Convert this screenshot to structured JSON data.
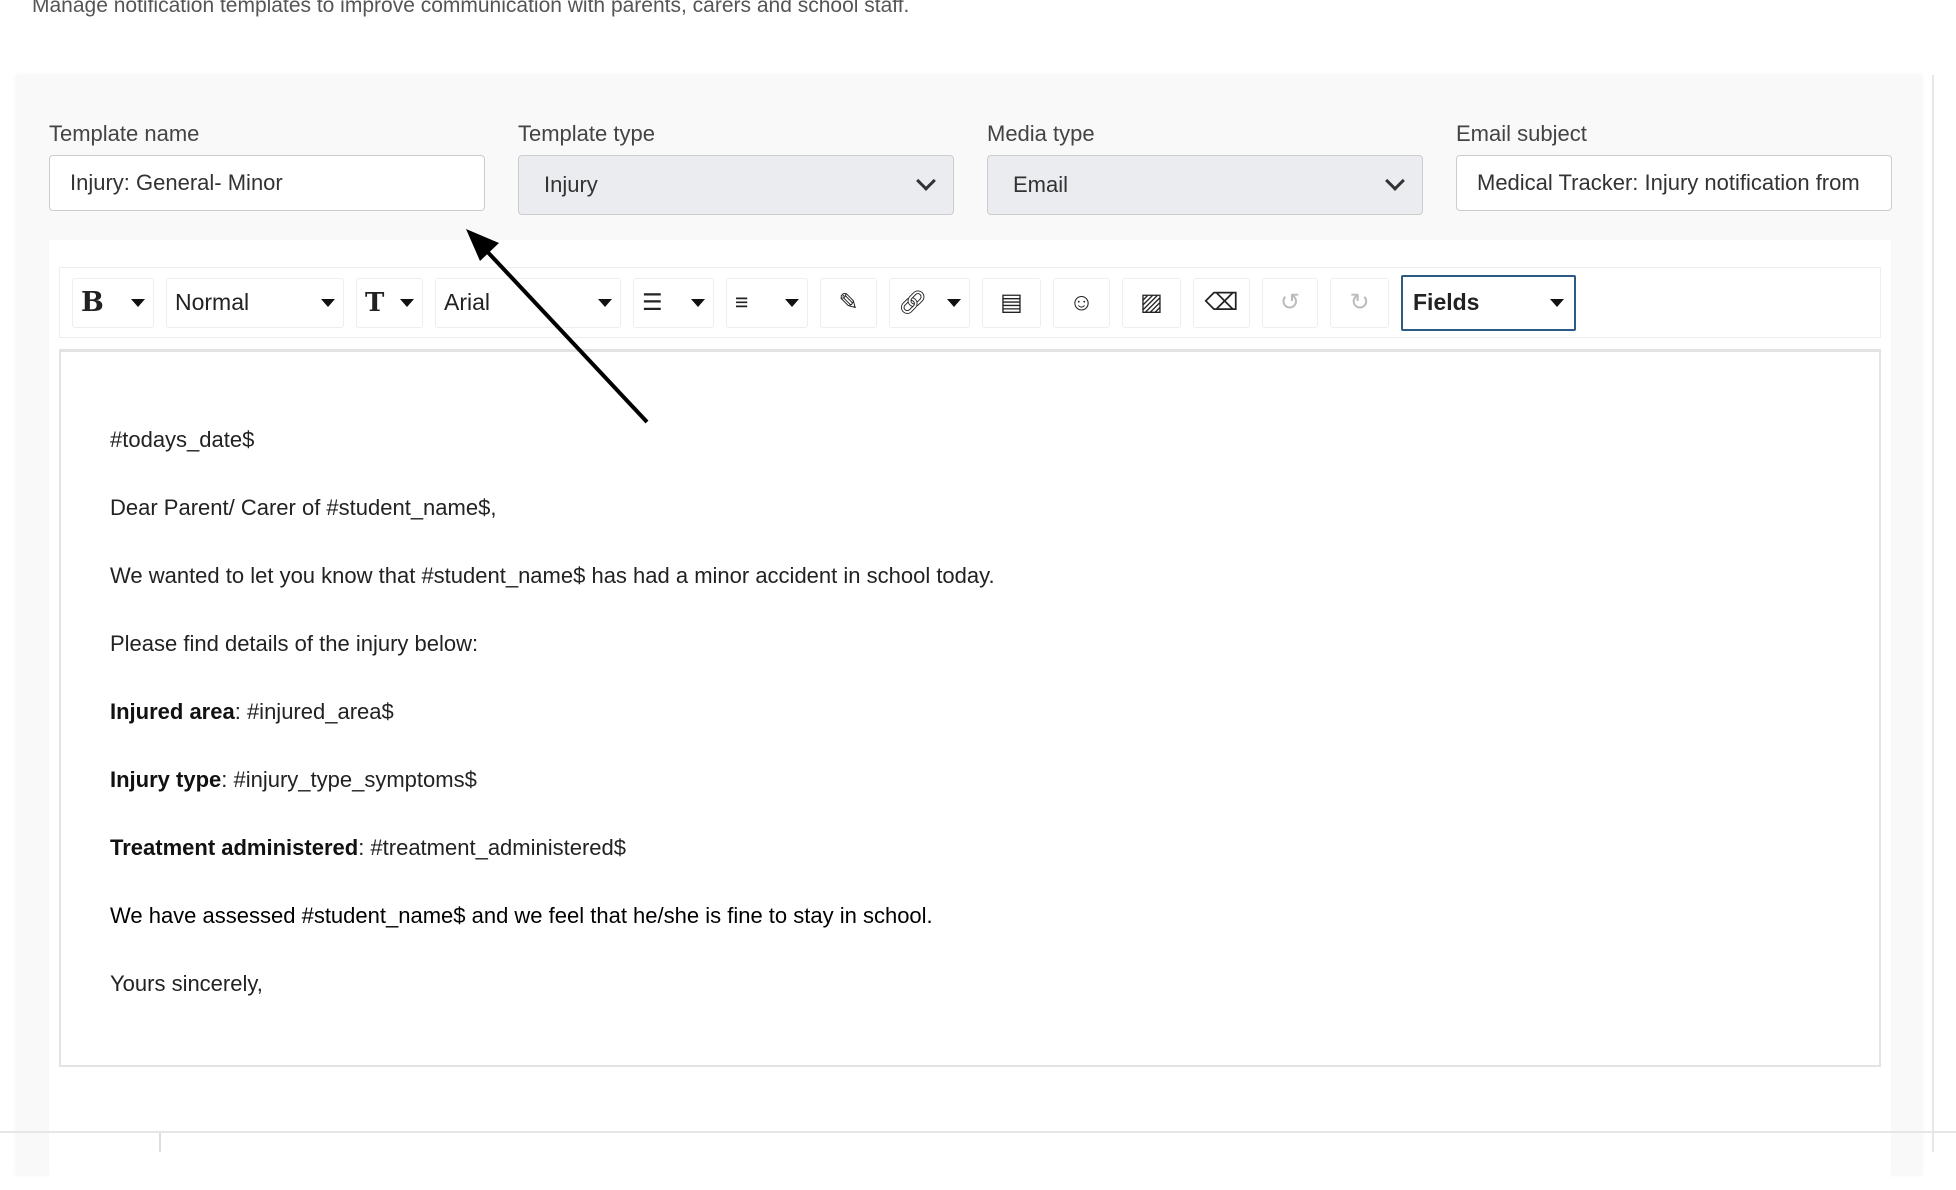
{
  "subtitle": "Manage notification templates to improve communication with parents, carers and school staff.",
  "form": {
    "template_name": {
      "label": "Template name",
      "value": "Injury: General- Minor"
    },
    "template_type": {
      "label": "Template type",
      "value": "Injury"
    },
    "media_type": {
      "label": "Media type",
      "value": "Email"
    },
    "email_subject": {
      "label": "Email subject",
      "value": "Medical Tracker: Injury notification from"
    }
  },
  "toolbar": {
    "bold": "B",
    "style": "Normal",
    "font_size": "T",
    "font": "Arial",
    "fields": "Fields"
  },
  "body": {
    "l1": "#todays_date$",
    "l2": "Dear Parent/ Carer of #student_name$,",
    "l3": "We wanted to let you know that #student_name$ has had a minor accident in school today.",
    "l4": "Please find details of the injury below:",
    "l5b": "Injured area",
    "l5": ": #injured_area$",
    "l6b": "Injury type",
    "l6": ": #injury_type_symptoms$",
    "l7b": "Treatment administered",
    "l7": ": #treatment_administered$",
    "l8": "We have assessed #student_name$ and we feel that he/she is fine to stay in school.",
    "l9": "Yours sincerely,"
  }
}
